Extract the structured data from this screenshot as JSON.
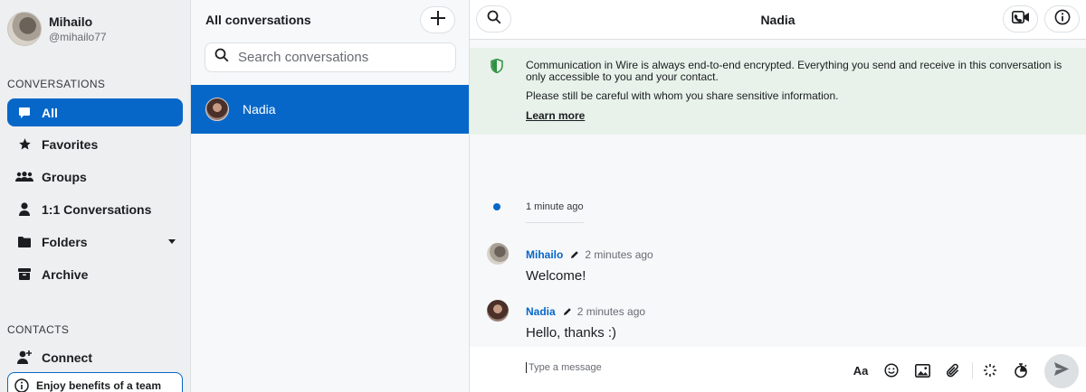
{
  "user": {
    "name": "Mihailo",
    "handle": "@mihailo77"
  },
  "sidebar": {
    "conversations_heading": "CONVERSATIONS",
    "items": [
      {
        "label": "All",
        "icon": "chat-bubble-icon",
        "active": true
      },
      {
        "label": "Favorites",
        "icon": "star-icon"
      },
      {
        "label": "Groups",
        "icon": "group-icon"
      },
      {
        "label": "1:1 Conversations",
        "icon": "person-icon"
      },
      {
        "label": "Folders",
        "icon": "folder-icon"
      },
      {
        "label": "Archive",
        "icon": "archive-icon"
      }
    ],
    "contacts_heading": "CONTACTS",
    "connect_label": "Connect",
    "team_banner": "Enjoy benefits of a team"
  },
  "conversation_list": {
    "title": "All conversations",
    "search_placeholder": "Search conversations",
    "items": [
      {
        "name": "Nadia",
        "selected": true
      }
    ]
  },
  "conversation": {
    "title": "Nadia",
    "notice": {
      "line1": "Communication in Wire is always end-to-end encrypted. Everything you send and receive in this conversation is only accessible to you and your contact.",
      "line2": "Please still be careful with whom you share sensitive information.",
      "learn_more": "Learn more"
    },
    "system_time": "1 minute ago",
    "messages": [
      {
        "sender": "Mihailo",
        "time": "2 minutes ago",
        "text": "Welcome!"
      },
      {
        "sender": "Nadia",
        "time": "2 minutes ago",
        "text": "Hello, thanks :)"
      }
    ],
    "input_placeholder": "Type a message",
    "format_label": "Aa"
  },
  "colors": {
    "accent": "#0667c8",
    "notice_bg": "#e8f2ea",
    "shield": "#2f8f42"
  }
}
